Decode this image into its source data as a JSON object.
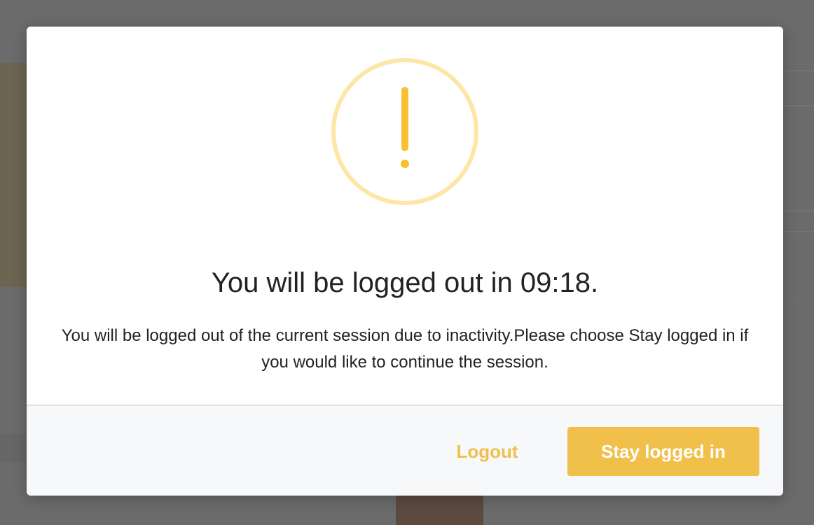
{
  "dialog": {
    "icon": "warning-exclamation-icon",
    "title": "You will be logged out in 09:18.",
    "message": "You will be logged out of the current session due to inactivity.Please choose Stay logged in if you would like to continue the session.",
    "buttons": {
      "logout_label": "Logout",
      "stay_label": "Stay logged in"
    }
  },
  "colors": {
    "accent": "#f0c04a",
    "icon_ring": "#fde6a6",
    "icon_mark": "#f8c132",
    "backdrop": "#6b6b6b"
  }
}
